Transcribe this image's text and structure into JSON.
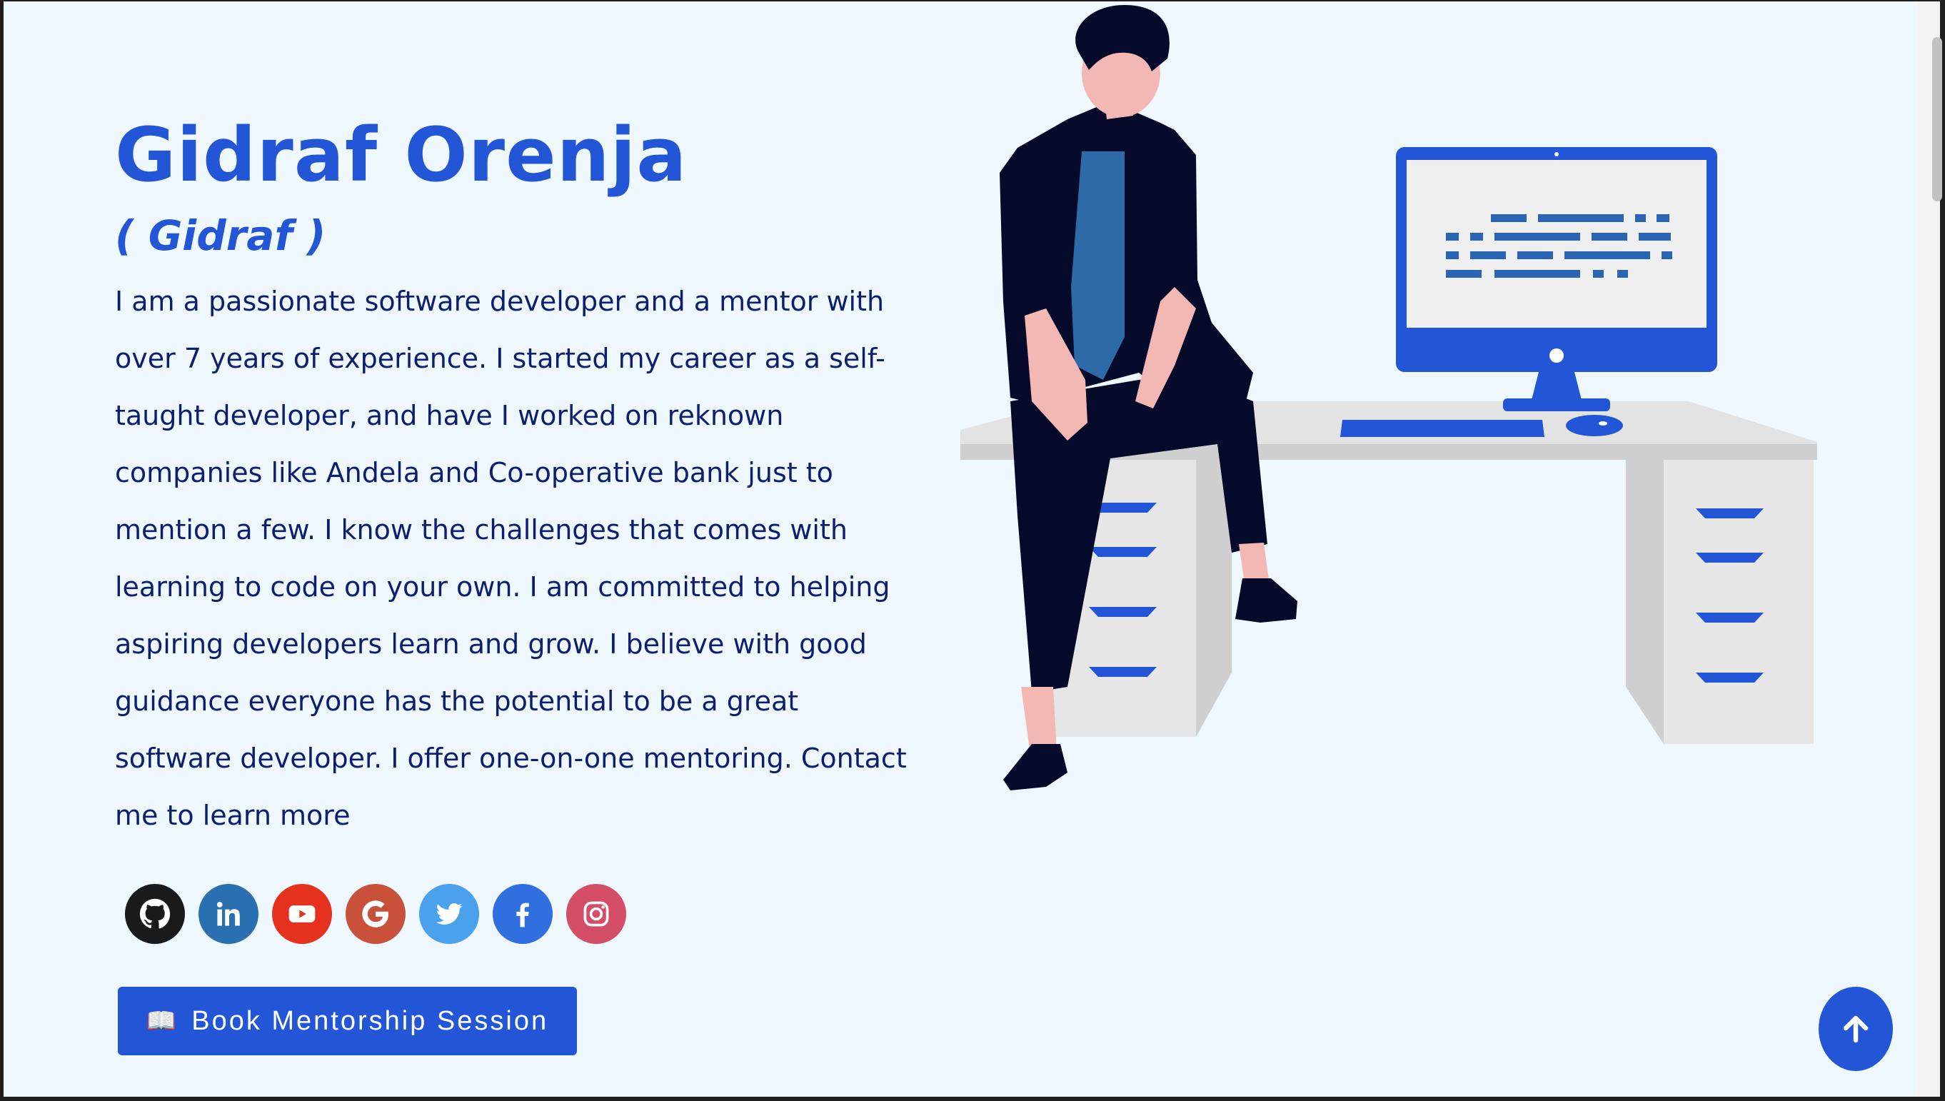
{
  "profile": {
    "name": "Gidraf Orenja",
    "nickname": "( Gidraf )",
    "bio": "I am a passionate software developer and a mentor with over 7 years of experience. I started my career as a self-taught developer, and have I worked on reknown companies like Andela and Co-operative bank just to mention a few. I know the challenges that comes with learning to code on your own. I am committed to helping aspiring developers learn and grow. I believe with good guidance everyone has the potential to be a great software developer. I offer one-on-one mentoring. Contact me to learn more"
  },
  "socials": [
    {
      "icon": "github-icon",
      "color": "#1a1a1a"
    },
    {
      "icon": "linkedin-icon",
      "color": "#2a6fb0"
    },
    {
      "icon": "youtube-icon",
      "color": "#e4321e"
    },
    {
      "icon": "google-icon",
      "color": "#c9513a"
    },
    {
      "icon": "twitter-icon",
      "color": "#4aa1ec"
    },
    {
      "icon": "facebook-icon",
      "color": "#2f6fe0"
    },
    {
      "icon": "instagram-icon",
      "color": "#d44e68"
    }
  ],
  "cta": {
    "icon": "open-book-icon",
    "label": "Book Mentorship Session"
  },
  "back_to_top": {
    "icon": "arrow-up-icon"
  },
  "colors": {
    "accent": "#2356d6",
    "page_background": "#eff8ff",
    "body_text": "#0c1e6e"
  }
}
